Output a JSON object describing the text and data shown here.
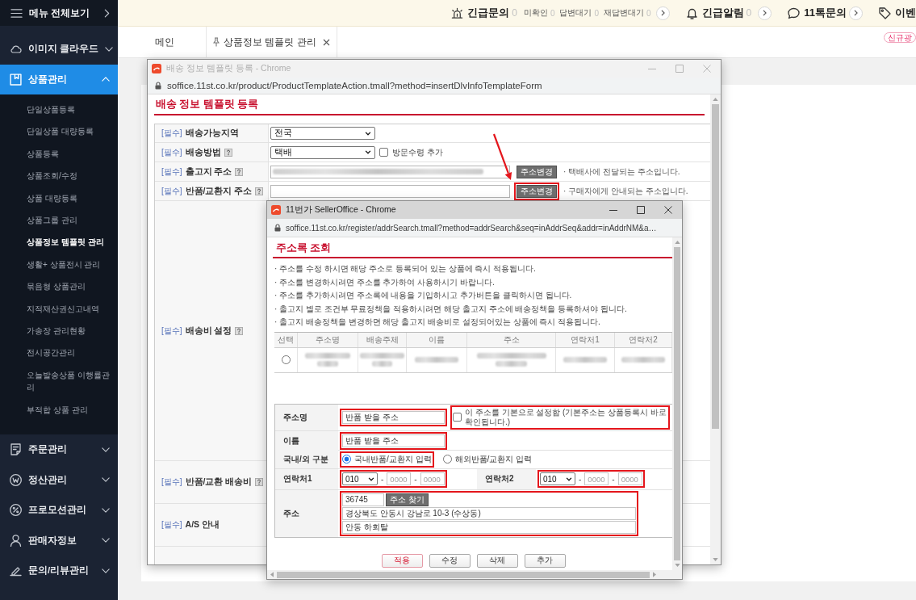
{
  "sidebar": {
    "header": {
      "label": "메뉴 전체보기"
    },
    "items": [
      {
        "label": "이미지 클라우드",
        "expanded": false
      },
      {
        "label": "상품관리",
        "expanded": true,
        "children": [
          {
            "label": "단일상품등록",
            "selected": false
          },
          {
            "label": "단일상품 대량등록",
            "selected": false
          },
          {
            "label": "상품등록",
            "selected": false
          },
          {
            "label": "상품조회/수정",
            "selected": false
          },
          {
            "label": "상품 대량등록",
            "selected": false
          },
          {
            "label": "상품그룹 관리",
            "selected": false
          },
          {
            "label": "상품정보 템플릿 관리",
            "selected": true
          },
          {
            "label": "생활+ 상품전시 관리",
            "selected": false
          },
          {
            "label": "묶음형 상품관리",
            "selected": false
          },
          {
            "label": "지적재산권신고내역",
            "selected": false
          },
          {
            "label": "가송장 관리현황",
            "selected": false
          },
          {
            "label": "전시공간관리",
            "selected": false
          },
          {
            "label": "오늘발송상품 이행률관리",
            "selected": false
          },
          {
            "label": "부적합 상품 관리",
            "selected": false
          }
        ]
      },
      {
        "label": "주문관리",
        "expanded": false
      },
      {
        "label": "정산관리",
        "expanded": false
      },
      {
        "label": "프로모션관리",
        "expanded": false
      },
      {
        "label": "판매자정보",
        "expanded": false
      },
      {
        "label": "문의/리뷰관리",
        "expanded": false
      }
    ]
  },
  "top_bar": {
    "alerts": [
      {
        "label": "긴급문의",
        "count": "0",
        "details": [
          {
            "label": "미확인",
            "count": "0"
          },
          {
            "label": "답변대기",
            "count": "0"
          },
          {
            "label": "재답변대기",
            "count": "0"
          }
        ],
        "more": true
      },
      {
        "label": "긴급알림",
        "count": "0",
        "more": true
      },
      {
        "label": "11톡문의",
        "more": true
      },
      {
        "label": "이벤",
        "badge": "신규광",
        "more": false
      }
    ]
  },
  "tabs": [
    {
      "label": "메인",
      "pinned": false,
      "closable": false
    },
    {
      "label": "상품정보 템플릿 관리",
      "pinned": true,
      "closable": true
    }
  ],
  "template_window": {
    "title": "배송 정보 템플릿 등록 - Chrome",
    "active": false,
    "url": "soffice.11st.co.kr/product/ProductTemplateAction.tmall?method=insertDlvInfoTemplateForm",
    "heading": "배송 정보 템플릿 등록",
    "rows": [
      {
        "kind": "select",
        "required": "[필수]",
        "label": "배송가능지역",
        "help": false,
        "value": "전국"
      },
      {
        "kind": "select_checkbox",
        "required": "[필수]",
        "label": "배송방법",
        "help": true,
        "value": "택배",
        "checkbox": {
          "label": "방문수령 추가",
          "checked": false
        }
      },
      {
        "kind": "address",
        "required": "[필수]",
        "label": "출고지 주소",
        "help": true,
        "blurred": true,
        "button": {
          "label": "주소변경",
          "highlighted": false
        },
        "note": "· 택배사에 전달되는 주소입니다."
      },
      {
        "kind": "address",
        "required": "[필수]",
        "label": "반품/교환지 주소",
        "help": true,
        "blurred": false,
        "button": {
          "label": "주소변경",
          "highlighted": true
        },
        "note": "· 구매자에게 안내되는 주소입니다."
      },
      {
        "kind": "tall",
        "required": "[필수]",
        "label": "배송비 설정",
        "help": true
      },
      {
        "kind": "short",
        "required": "[필수]",
        "label": "반품/교환 배송비",
        "help": true
      },
      {
        "kind": "short",
        "required": "[필수]",
        "label": "A/S 안내",
        "help": false
      }
    ]
  },
  "address_window": {
    "title": "11번가 SellerOffice - Chrome",
    "active": true,
    "url": "soffice.11st.co.kr/register/addrSearch.tmall?method=addrSearch&seq=inAddrSeq&addr=inAddrNM&a…",
    "heading": "주소록 조회",
    "notes": [
      "· 주소를 수정 하시면 해당 주소로 등록되어 있는 상품에 즉시 적용됩니다.",
      "· 주소를 변경하시려면 주소를 추가하여 사용하시기 바랍니다.",
      "· 주소를 추가하시려면 주소록에 내용을 기입하시고 추가버튼을 클릭하시면 됩니다.",
      "· 출고지 별로 조건부 무료정책을 적용하시려면 해당 출고지 주소에 배송정책을 등록하셔야 됩니다.",
      "· 출고지 배송정책을 변경하면 해당 출고지 배송비로 설정되어있는 상품에 즉시 적용됩니다."
    ],
    "table": {
      "columns": [
        "선택",
        "주소명",
        "배송주체",
        "이름",
        "주소",
        "연락처1",
        "연락처2"
      ],
      "rows": [
        {
          "selected": false
        }
      ]
    },
    "form": {
      "address_name": {
        "label": "주소명",
        "value": "반품 받을 주소",
        "highlighted": true
      },
      "default_checkbox": {
        "label": "이 주소를 기본으로 설정함 (기본주소는 상품등록시 바로 확인됩니다.)",
        "checked": false,
        "highlighted": true
      },
      "name": {
        "label": "이름",
        "value": "반품 받을 주소",
        "highlighted": true
      },
      "region": {
        "label": "국내/외 구분",
        "options": [
          {
            "label": "국내반품/교환지 입력",
            "selected": true,
            "highlighted": true
          },
          {
            "label": "해외반품/교환지 입력",
            "selected": false,
            "highlighted": false
          }
        ]
      },
      "phones": [
        {
          "label": "연락처1",
          "highlighted": true,
          "parts": [
            {
              "kind": "select",
              "value": "010"
            },
            {
              "kind": "text",
              "text": "-"
            },
            {
              "kind": "input",
              "placeholder": "0000"
            },
            {
              "kind": "text",
              "text": "-"
            },
            {
              "kind": "input",
              "placeholder": "0000"
            }
          ]
        },
        {
          "label": "연락처2",
          "highlighted": true,
          "parts": [
            {
              "kind": "select",
              "value": "010"
            },
            {
              "kind": "text",
              "text": "-"
            },
            {
              "kind": "input",
              "placeholder": "0000"
            },
            {
              "kind": "text",
              "text": "-"
            },
            {
              "kind": "input",
              "placeholder": "0000"
            }
          ]
        }
      ],
      "address": {
        "label": "주소",
        "zip": "36745",
        "search_button": "주소 찾기",
        "line1": "경상북도 안동시 강남로 10-3 (수상동)",
        "line2": "안동 하회탈",
        "highlighted": true
      }
    },
    "buttons": [
      {
        "label": "적용",
        "kind": "primary"
      },
      {
        "label": "수정",
        "kind": "default"
      },
      {
        "label": "삭제",
        "kind": "default"
      },
      {
        "label": "추가",
        "kind": "default"
      }
    ]
  }
}
